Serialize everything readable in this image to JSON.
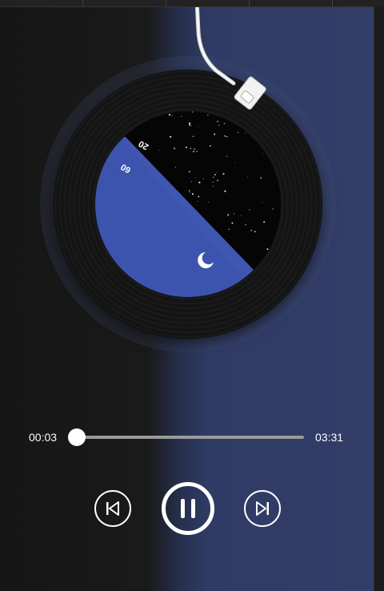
{
  "player": {
    "current_time": "00:03",
    "duration": "03:31",
    "progress_fraction": 0.05,
    "state": "playing"
  },
  "record": {
    "label_text_1": "20",
    "label_text_2": "60"
  },
  "icons": {
    "previous": "skip-previous-icon",
    "pause": "pause-icon",
    "next": "skip-next-icon",
    "moon": "crescent-moon-icon"
  },
  "colors": {
    "sky_blue": "#3f56b2",
    "night": "#050505",
    "background_blue": "#323e69",
    "control": "#ffffff"
  }
}
